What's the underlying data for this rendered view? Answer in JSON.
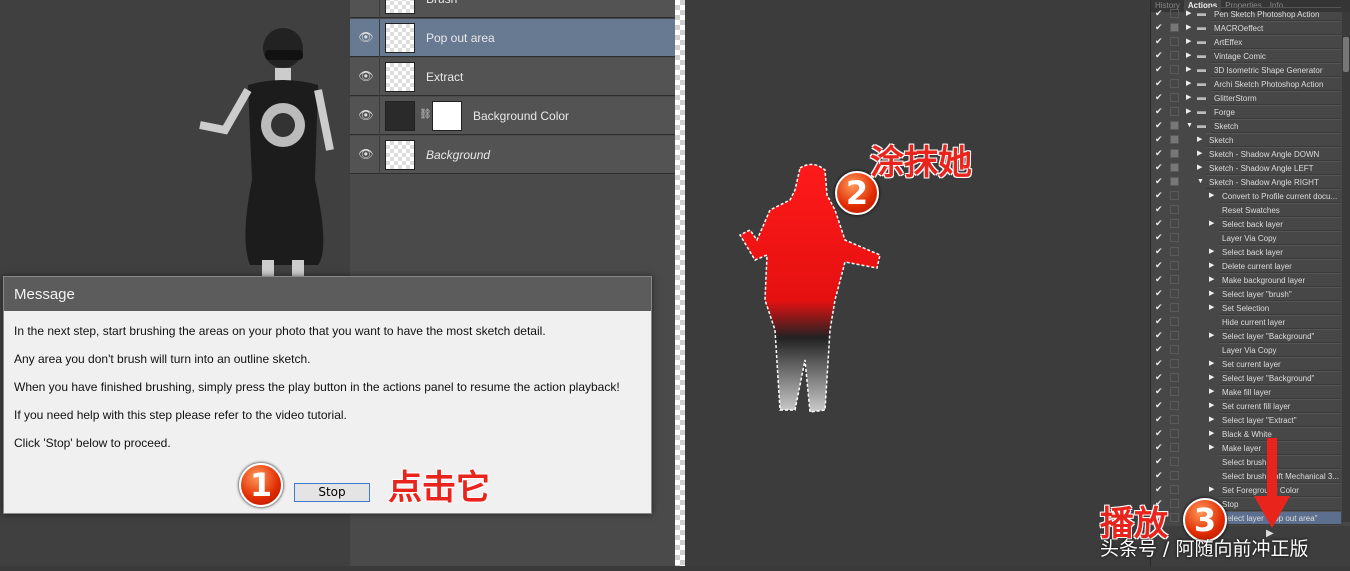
{
  "layers": [
    {
      "name": "Brush"
    },
    {
      "name": "Pop out area",
      "selected": true
    },
    {
      "name": "Extract"
    },
    {
      "name": "Background Color"
    },
    {
      "name": "Background"
    }
  ],
  "actions_panel": {
    "tabs": [
      "History",
      "Actions",
      "Properties",
      "Info"
    ],
    "active_tab": "Actions",
    "rows": [
      {
        "label": "Pen Sketch Photoshop Action",
        "level": 0,
        "folder": true,
        "open": false,
        "modal": false
      },
      {
        "label": "MACROeffect",
        "level": 0,
        "folder": true,
        "open": false,
        "modal": true
      },
      {
        "label": "ArtEffex",
        "level": 0,
        "folder": true,
        "open": false,
        "modal": false
      },
      {
        "label": "Vintage Comic",
        "level": 0,
        "folder": true,
        "open": false,
        "modal": false
      },
      {
        "label": "3D Isometric Shape Generator",
        "level": 0,
        "folder": true,
        "open": false,
        "modal": false
      },
      {
        "label": "Archi Sketch Photoshop Action",
        "level": 0,
        "folder": true,
        "open": false,
        "modal": false
      },
      {
        "label": "GlitterStorm",
        "level": 0,
        "folder": true,
        "open": false,
        "modal": false
      },
      {
        "label": "Forge",
        "level": 0,
        "folder": true,
        "open": false,
        "modal": false
      },
      {
        "label": "Sketch",
        "level": 0,
        "folder": true,
        "open": true,
        "modal": true
      },
      {
        "label": "Sketch",
        "level": 1,
        "expand": "closed",
        "modal": true
      },
      {
        "label": "Sketch - Shadow Angle DOWN",
        "level": 1,
        "expand": "closed",
        "modal": true
      },
      {
        "label": "Sketch - Shadow Angle LEFT",
        "level": 1,
        "expand": "closed",
        "modal": true
      },
      {
        "label": "Sketch - Shadow Angle RIGHT",
        "level": 1,
        "expand": "open",
        "modal": true
      },
      {
        "label": "Convert to Profile current docu...",
        "level": 2,
        "expand": "closed"
      },
      {
        "label": "Reset Swatches",
        "level": 2
      },
      {
        "label": "Select back layer",
        "level": 2,
        "expand": "closed"
      },
      {
        "label": "Layer Via Copy",
        "level": 2
      },
      {
        "label": "Select back layer",
        "level": 2,
        "expand": "closed"
      },
      {
        "label": "Delete current layer",
        "level": 2,
        "expand": "closed"
      },
      {
        "label": "Make background layer",
        "level": 2,
        "expand": "closed"
      },
      {
        "label": "Select layer \"brush\"",
        "level": 2,
        "expand": "closed"
      },
      {
        "label": "Set Selection",
        "level": 2,
        "expand": "closed"
      },
      {
        "label": "Hide current layer",
        "level": 2
      },
      {
        "label": "Select layer \"Background\"",
        "level": 2,
        "expand": "closed"
      },
      {
        "label": "Layer Via Copy",
        "level": 2
      },
      {
        "label": "Set current layer",
        "level": 2,
        "expand": "closed"
      },
      {
        "label": "Select layer \"Background\"",
        "level": 2,
        "expand": "closed"
      },
      {
        "label": "Make fill layer",
        "level": 2,
        "expand": "closed"
      },
      {
        "label": "Set current fill layer",
        "level": 2,
        "expand": "closed"
      },
      {
        "label": "Select layer \"Extract\"",
        "level": 2,
        "expand": "closed"
      },
      {
        "label": "Black & White",
        "level": 2,
        "expand": "closed"
      },
      {
        "label": "Make layer",
        "level": 2,
        "expand": "closed"
      },
      {
        "label": "Select brush",
        "level": 2
      },
      {
        "label": "Select brush Soft Mechanical 3...",
        "level": 2
      },
      {
        "label": "Set Foreground Color",
        "level": 2,
        "expand": "closed"
      },
      {
        "label": "Stop",
        "level": 2
      },
      {
        "label": "Select layer \"Pop out area\"",
        "level": 2,
        "highlight": true
      }
    ]
  },
  "message_dialog": {
    "title": "Message",
    "lines": [
      "In the next step, start brushing the areas on your photo that you want to have the most sketch detail.",
      "Any area you don't brush will turn into an outline sketch.",
      "When you have finished brushing, simply press the play button in the actions panel to resume the action playback!",
      "If you need help with this step please refer to the video tutorial.",
      "Click 'Stop' below to proceed."
    ],
    "stop_label": "Stop"
  },
  "annotations": {
    "step1": "1",
    "step1_text": "点击它",
    "step2": "2",
    "step2_text": "涂抹她",
    "step3": "3",
    "step3_text": "播放",
    "watermark": "头条号 / 阿随向前冲正版",
    "accent": "#e8241c"
  }
}
